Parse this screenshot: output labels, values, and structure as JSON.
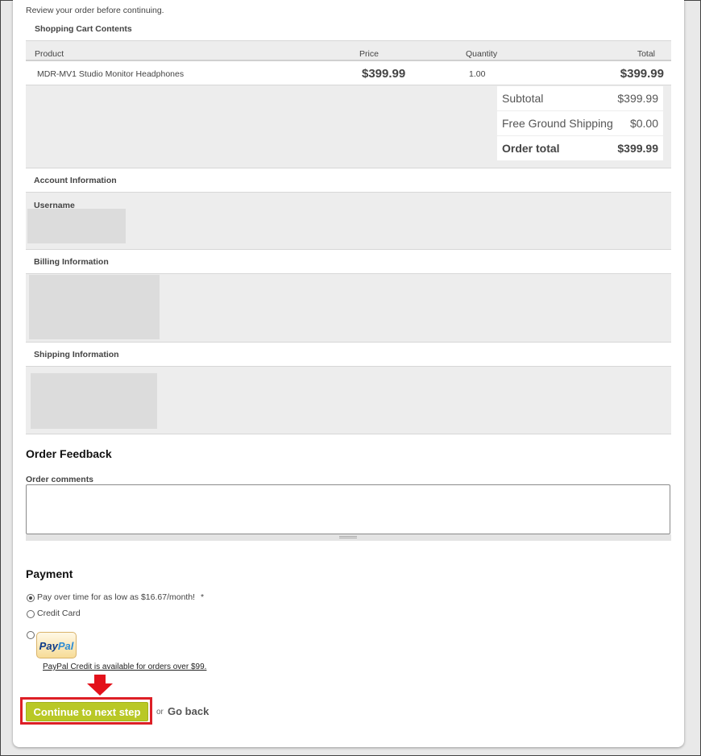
{
  "intro": "Review your order before continuing.",
  "cart": {
    "title": "Shopping Cart Contents",
    "columns": [
      "Product",
      "Price",
      "Quantity",
      "Total"
    ],
    "rows": [
      {
        "product": "MDR-MV1 Studio Monitor Headphones",
        "price": "$399.99",
        "quantity": "1.00",
        "total": "$399.99"
      }
    ],
    "summary": [
      {
        "label": "Subtotal",
        "value": "$399.99"
      },
      {
        "label": "Free Ground Shipping",
        "value": "$0.00"
      },
      {
        "label": "Order total",
        "value": "$399.99"
      }
    ]
  },
  "account": {
    "title": "Account Information",
    "username_label": "Username"
  },
  "billing": {
    "title": "Billing Information"
  },
  "shipping": {
    "title": "Shipping Information"
  },
  "feedback": {
    "title": "Order Feedback",
    "comments_label": "Order comments",
    "comments_value": ""
  },
  "payment": {
    "title": "Payment",
    "options": [
      {
        "label": "Pay over time for as low as $16.67/month!",
        "required_mark": "*",
        "selected": true
      },
      {
        "label": "Credit Card",
        "selected": false
      },
      {
        "label": "",
        "selected": false
      }
    ],
    "paypal_logo": {
      "part1": "Pay",
      "part2": "Pal"
    },
    "paypal_note": "PayPal Credit is available for orders over $99."
  },
  "actions": {
    "continue_label": "Continue to next step",
    "or_text": "or",
    "back_label": "Go back"
  },
  "colors": {
    "continue_button": "#b9c826",
    "highlight": "#dd1f26",
    "panel": "#ededed"
  }
}
